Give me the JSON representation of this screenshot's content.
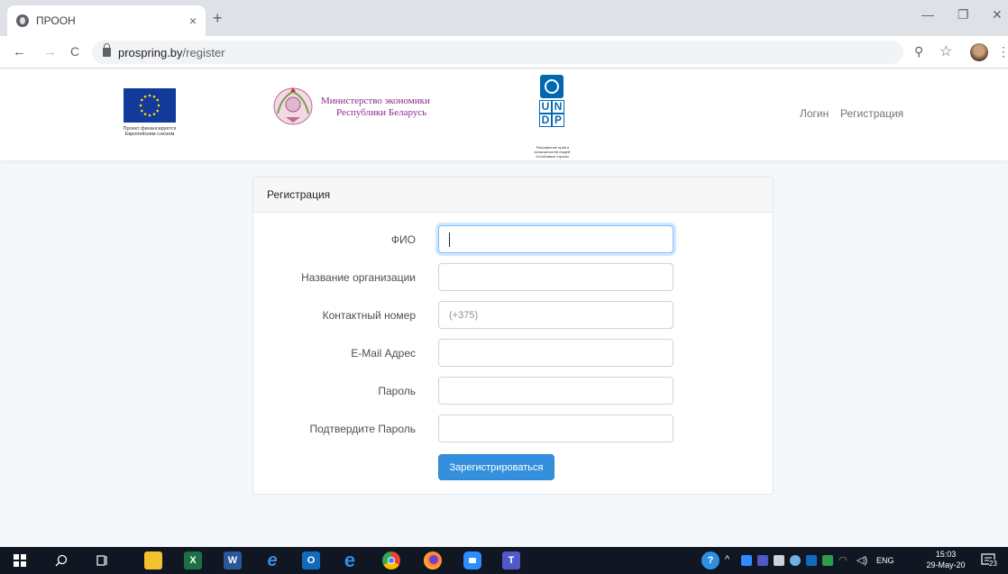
{
  "browser": {
    "tab_title": "ПРООН",
    "tab_close": "×",
    "new_tab": "+",
    "url_host": "prospring.by",
    "url_path": "/register",
    "window_controls": {
      "minimize": "—",
      "restore": "❐",
      "close": "✕"
    },
    "nav_icons": {
      "back": "←",
      "forward": "→",
      "reload": "C"
    },
    "right_icons": {
      "zoom": "⚲",
      "bookmark": "☆",
      "menu": "⋮"
    }
  },
  "header": {
    "eu_caption_line1": "Проект финансируется",
    "eu_caption_line2": "Европейским союзом",
    "ministry_line1": "Министерство экономики",
    "ministry_line2": "Республики Беларусь",
    "undp_letters": [
      "U",
      "N",
      "D",
      "P"
    ],
    "undp_caption_line1": "Расширение прав и возможностей людей.",
    "undp_caption_line2": "Устойчивые страны.",
    "nav": {
      "login": "Логин",
      "register": "Регистрация"
    }
  },
  "form": {
    "title": "Регистрация",
    "fields": [
      {
        "label": "ФИО",
        "value": "",
        "placeholder": ""
      },
      {
        "label": "Название организации",
        "value": "",
        "placeholder": ""
      },
      {
        "label": "Контактный номер",
        "value": "",
        "placeholder": "(+375)"
      },
      {
        "label": "E-Mail Адрес",
        "value": "",
        "placeholder": ""
      },
      {
        "label": "Пароль",
        "value": "",
        "placeholder": ""
      },
      {
        "label": "Подтвердите Пароль",
        "value": "",
        "placeholder": ""
      }
    ],
    "submit_label": "Зарегистрироваться",
    "accent_color": "#3490dc"
  },
  "taskbar": {
    "apps": [
      "start-icon",
      "search-icon",
      "task-view-icon",
      "file-explorer-icon",
      "excel-icon",
      "word-icon",
      "edge-legacy-icon",
      "outlook-icon",
      "edge-icon",
      "chrome-icon",
      "firefox-icon",
      "zoom-icon",
      "teams-icon"
    ],
    "language": "ENG",
    "time": "15:03",
    "date": "29-May-20",
    "notification_count": "23"
  }
}
